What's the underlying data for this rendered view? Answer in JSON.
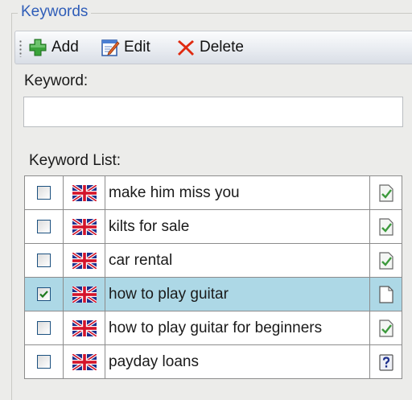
{
  "group": {
    "title": "Keywords"
  },
  "toolbar": {
    "add_label": "Add",
    "edit_label": "Edit",
    "delete_label": "Delete"
  },
  "form": {
    "keyword_label": "Keyword:",
    "keyword_value": "",
    "list_label": "Keyword List:"
  },
  "keywords": [
    {
      "text": "make him miss you",
      "checked": false,
      "status": "complete",
      "selected": false,
      "flag": "uk-flag-icon"
    },
    {
      "text": "kilts for sale",
      "checked": false,
      "status": "complete",
      "selected": false,
      "flag": "uk-flag-icon"
    },
    {
      "text": "car rental",
      "checked": false,
      "status": "complete",
      "selected": false,
      "flag": "uk-flag-icon"
    },
    {
      "text": "how to play guitar",
      "checked": true,
      "status": "blank",
      "selected": true,
      "flag": "uk-flag-icon"
    },
    {
      "text": "how to play guitar for beginners",
      "checked": false,
      "status": "complete",
      "selected": false,
      "flag": "uk-flag-icon"
    },
    {
      "text": "payday loans",
      "checked": false,
      "status": "unknown",
      "selected": false,
      "flag": "uk-flag-icon"
    }
  ],
  "colors": {
    "group_title": "#2f5db8",
    "selected_row": "#add8e6",
    "add_icon": "#3aa33a",
    "delete_icon": "#e02a10",
    "status_check": "#3c9a3c"
  }
}
